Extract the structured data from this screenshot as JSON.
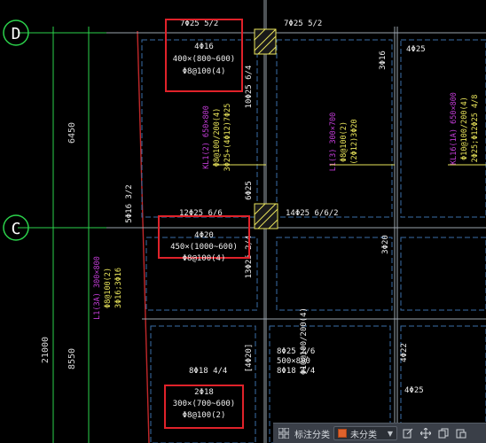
{
  "axes": {
    "D": "D",
    "C": "C",
    "dim_6450": "6450",
    "dim_21000": "21000",
    "dim_8550": "8550"
  },
  "annotations": {
    "top_left_beam": "7Φ25 5/2",
    "top_right_beam": "7Φ25 5/2",
    "mid_left_beam": "12Φ25 6/6",
    "mid_right_beam": "14Φ25 6/6/2",
    "left_col_vert": "5Φ16 3/2",
    "col_10": "10Φ25 6/4",
    "col_6": "6Φ25",
    "col_13": "13Φ25 2/4",
    "right_3_20_top": "3Φ16",
    "right_4_25": "4Φ25",
    "right_3_20_mid": "3Φ20",
    "bottom_8_18_left": "8Φ18 4/4",
    "bottom_4_20": "[4Φ20]",
    "bottom_8_25": "8Φ25 2/6",
    "bottom_500x800": "500×800",
    "bottom_phi10": "Φ10@100/200(4)",
    "bottom_8_18_right": "8Φ18 4/4",
    "right_4_22": "4Φ22",
    "right_4_25_bottom": "4Φ25"
  },
  "boxes": [
    {
      "line1": "4Φ16",
      "line2": "400×(800~600)",
      "line3": "Φ8@100(4)"
    },
    {
      "line1": "4Φ20",
      "line2": "450×(1000~600)",
      "line3": "Φ8@100(4)"
    },
    {
      "line1": "2Φ18",
      "line2": "300×(700~600)",
      "line3": "Φ8@100(2)"
    }
  ],
  "beam_labels": {
    "kl1": {
      "l1": "KL1(2) 650×800",
      "l2": "Φ8@100/200(4)",
      "l3": "3Φ25+(4Φ12)7Φ25"
    },
    "l1": {
      "l1": "L1(3) 300×700",
      "l2": "Φ8@100(2)",
      "l3": "(2Φ12)3Φ20"
    },
    "kl16": {
      "l1": "KL16(1A) 650×800",
      "l2": "Φ10@100/200(4)",
      "l3": "2Φ25;Φ12Φ25 4/8"
    },
    "l1_left": {
      "l1": "L1(3A) 300×800",
      "l2": "Φ8@100(2)",
      "l3": "3Φ16;3Φ16"
    }
  },
  "toolbar": {
    "classify_label": "标注分类",
    "dropdown_value": "未分类"
  },
  "colors": {
    "accent_red": "#e0222a",
    "axis_green": "#2bd24b",
    "magenta": "#c23cd6",
    "yellow": "#e8e35a",
    "white": "#f0f0f0",
    "dash_blue": "#3a6ea8"
  }
}
